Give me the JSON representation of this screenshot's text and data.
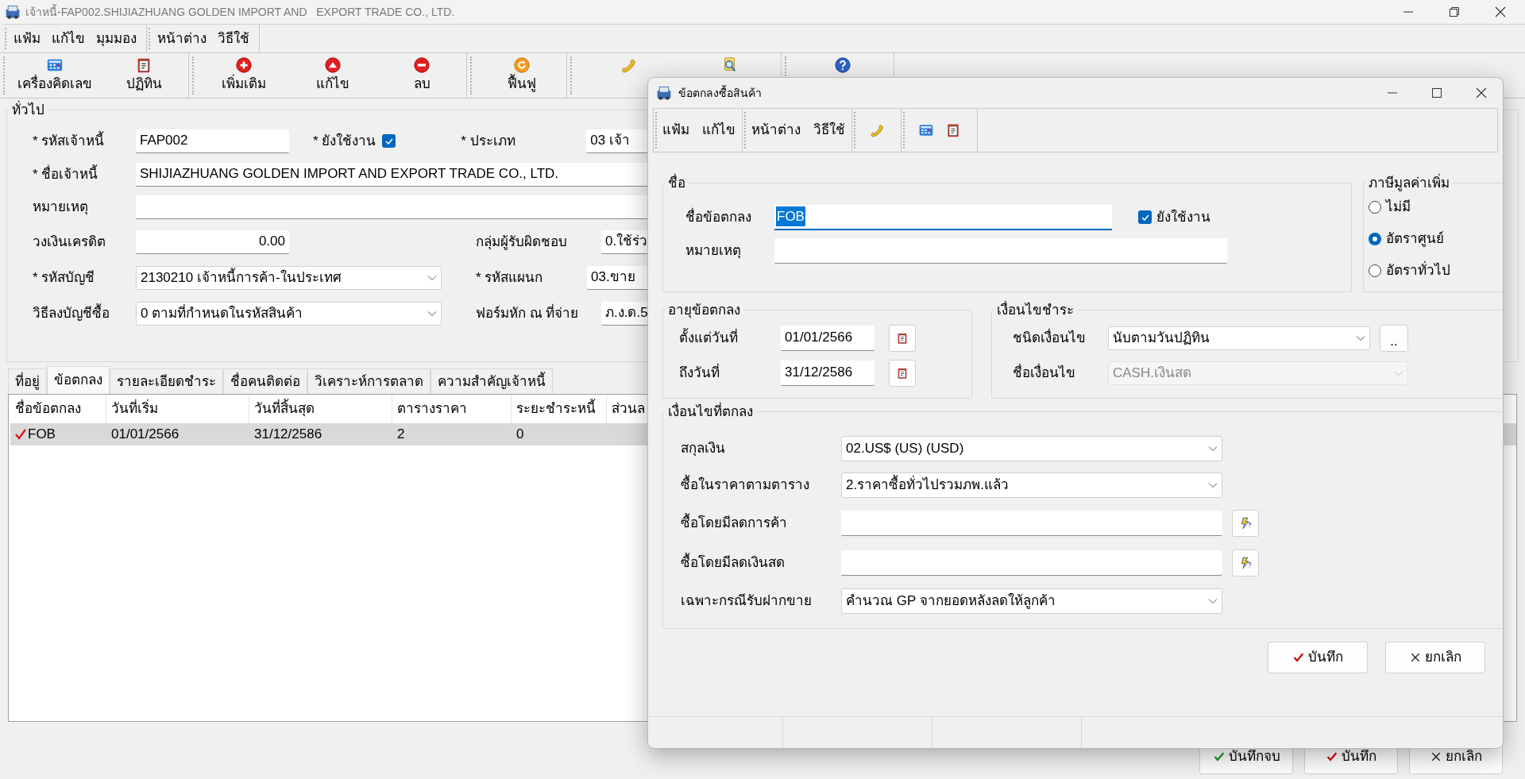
{
  "main": {
    "title": "เจ้าหนี้-FAP002.SHIJIAZHUANG GOLDEN IMPORT AND   EXPORT TRADE CO., LTD.",
    "menu_groups": [
      [
        "แฟ้ม",
        "แก้ไข",
        "มุมมอง"
      ],
      [
        "หน้าต่าง",
        "วิธีใช้"
      ]
    ],
    "toolbar_groups": [
      [
        {
          "kind": "calculator",
          "label": "เครื่องคิดเลข"
        },
        {
          "kind": "calendar",
          "label": "ปฏิทิน"
        }
      ],
      [
        {
          "kind": "add",
          "label": "เพิ่มเติม"
        },
        {
          "kind": "edit",
          "label": "แก้ไข"
        },
        {
          "kind": "delete",
          "label": "ลบ"
        }
      ],
      [
        {
          "kind": "refresh",
          "label": "ฟื้นฟู"
        }
      ],
      [
        {
          "kind": "phone"
        },
        {
          "kind": "search"
        }
      ],
      [
        {
          "kind": "help"
        }
      ]
    ],
    "general": {
      "title": "ทั่วไป",
      "creditor_code": {
        "label": "* รหัสเจ้าหนี้",
        "value": "FAP002"
      },
      "active": {
        "label": "* ยังใช้งาน",
        "checked": true
      },
      "type": {
        "label": "* ประเภท",
        "value": "03 เจ้า"
      },
      "name": {
        "label": "* ชื่อเจ้าหนี้",
        "value": "SHIJIAZHUANG GOLDEN IMPORT AND   EXPORT TRADE CO., LTD."
      },
      "note": {
        "label": "หมายเหตุ"
      },
      "credit_limit": {
        "label": "วงเงินเครดิต",
        "value": "0.00"
      },
      "responsible_group": {
        "label": "กลุ่มผู้รับผิดชอบ",
        "value": "0.ใช้ร่ว"
      },
      "account": {
        "label": "* รหัสบัญชี",
        "value": "2130210 เจ้าหนี้การค้า-ในประเทศ"
      },
      "department": {
        "label": "* รหัสแผนก",
        "value": "03.ขาย"
      },
      "posting_method": {
        "label": "วิธีลงบัญชีซื้อ",
        "value": "0 ตามที่กำหนดในรหัสสินค้า"
      },
      "withholding_form": {
        "label": "ฟอร์มหัก ณ ที่จ่าย",
        "value": "ภ.ง.ด.5"
      }
    },
    "tabs": [
      {
        "label": "ที่อยู่",
        "selected": false
      },
      {
        "label": "ข้อตกลง",
        "selected": true
      },
      {
        "label": "รายละเอียดชำระ",
        "selected": false
      },
      {
        "label": "ชื่อคนติดต่อ",
        "selected": false
      },
      {
        "label": "วิเคราะห์การตลาด",
        "selected": false
      },
      {
        "label": "ความสำคัญเจ้าหนี้",
        "selected": false
      }
    ],
    "table": {
      "columns": [
        "ชื่อข้อตกลง",
        "วันที่เริ่ม",
        "วันที่สิ้นสุด",
        "ตารางราคา",
        "ระยะชำระหนี้",
        "ส่วนล"
      ],
      "rows": [
        {
          "checked": true,
          "selected": true,
          "cells": [
            "FOB",
            "01/01/2566",
            "31/12/2586",
            "2",
            "0"
          ]
        }
      ]
    },
    "buttons": [
      {
        "kind": "finish",
        "label": "บันทึกจบ"
      },
      {
        "kind": "save",
        "label": "บันทึก"
      },
      {
        "kind": "cancel",
        "label": "ยกเลิก"
      }
    ]
  },
  "dialog": {
    "title": "ข้อตกลงซื้อสินค้า",
    "menu_groups": [
      [
        "แฟ้ม",
        "แก้ไข"
      ],
      [
        "หน้าต่าง",
        "วิธีใช้"
      ]
    ],
    "toolbar_groups": [
      [
        {
          "kind": "phone"
        }
      ],
      [
        {
          "kind": "calculator"
        },
        {
          "kind": "calendar"
        }
      ]
    ],
    "name_group": {
      "title": "ชื่อ",
      "agreement_name": {
        "label": "ชื่อข้อตกลง",
        "value": "FOB"
      },
      "active": {
        "label": "ยังใช้งาน",
        "checked": true
      },
      "note": {
        "label": "หมายเหตุ"
      }
    },
    "vat": {
      "title": "ภาษีมูลค่าเพิ่ม",
      "options": [
        {
          "label": "ไม่มี",
          "selected": false
        },
        {
          "label": "อัตราศูนย์",
          "selected": true
        },
        {
          "label": "อัตราทั่วไป",
          "selected": false
        }
      ]
    },
    "period": {
      "title": "อายุข้อตกลง",
      "rows": [
        {
          "label": "ตั้งแต่วันที่",
          "value": "01/01/2566"
        },
        {
          "label": "ถึงวันที่",
          "value": "31/12/2586"
        }
      ]
    },
    "payment": {
      "title": "เงื่อนไขชำระ",
      "condition_type": {
        "label": "ชนิดเงื่อนไข",
        "value": "นับตามวันปฏิทิน"
      },
      "more_button": "..",
      "condition_name": {
        "label": "ชื่อเงื่อนไข",
        "value": "CASH.เงินสด",
        "disabled": true
      }
    },
    "terms": {
      "title": "เงื่อนไขที่ตกลง",
      "rows": [
        {
          "kind": "dropdown",
          "label": "สกุลเงิน",
          "value": "02.US$ (US) (USD)"
        },
        {
          "kind": "dropdown",
          "label": "ซื้อในราคาตามตาราง",
          "value": "2.ราคาซื้อทั่วไปรวมภพ.แล้ว"
        },
        {
          "kind": "lookup",
          "label": "ซื้อโดยมีลดการค้า"
        },
        {
          "kind": "lookup",
          "label": "ซื้อโดยมีลดเงินสด"
        },
        {
          "kind": "dropdown",
          "label": "เฉพาะกรณีรับฝากขาย",
          "value": "คำนวณ GP จากยอดหลังลดให้ลูกค้า"
        }
      ]
    },
    "buttons": [
      {
        "kind": "save",
        "label": "บันทึก"
      },
      {
        "kind": "cancel",
        "label": "ยกเลิก"
      }
    ]
  }
}
